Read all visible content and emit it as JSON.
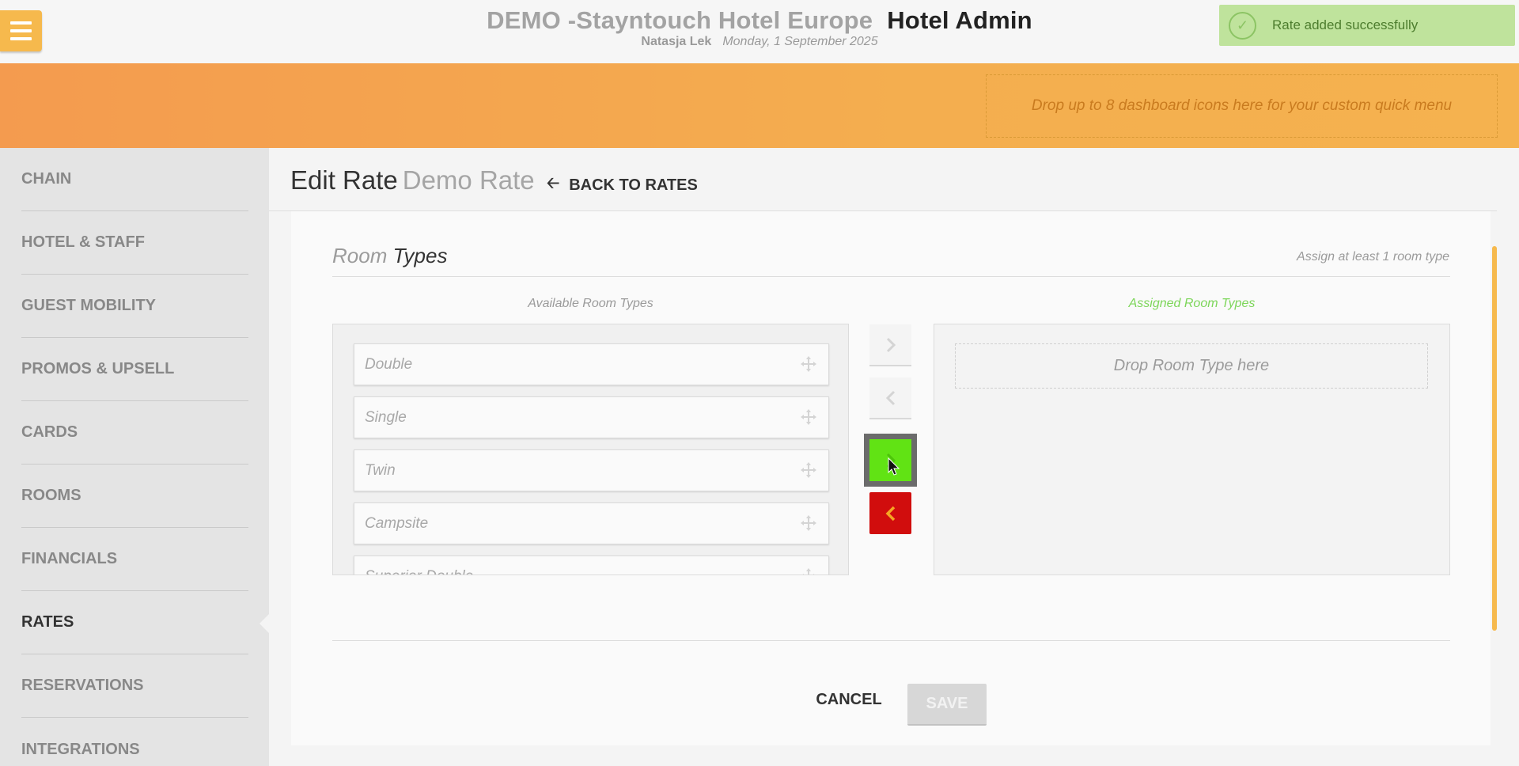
{
  "header": {
    "hotel_name": "DEMO -Stayntouch Hotel Europe",
    "app_name": "Hotel Admin",
    "user": "Natasja Lek",
    "date": "Monday, 1 September 2025",
    "menu_icon": "hamburger-menu-icon"
  },
  "toast": {
    "message": "Rate added successfully",
    "icon": "check-circle-icon"
  },
  "quick_menu": {
    "placeholder": "Drop up to 8 dashboard icons here for your custom quick menu"
  },
  "sidebar": {
    "items": [
      {
        "label": "CHAIN"
      },
      {
        "label": "HOTEL & STAFF"
      },
      {
        "label": "GUEST MOBILITY"
      },
      {
        "label": "PROMOS & UPSELL"
      },
      {
        "label": "CARDS"
      },
      {
        "label": "ROOMS"
      },
      {
        "label": "FINANCIALS"
      },
      {
        "label": "RATES",
        "active": true
      },
      {
        "label": "RESERVATIONS"
      },
      {
        "label": "INTEGRATIONS"
      }
    ]
  },
  "page": {
    "title": "Edit Rate",
    "rate_name": "Demo Rate",
    "back_label": "BACK TO RATES"
  },
  "room_types": {
    "title_light": "Room",
    "title_dark": "Types",
    "note": "Assign at least 1 room type",
    "available_label": "Available Room Types",
    "assigned_label": "Assigned Room Types",
    "available": [
      "Double",
      "Single",
      "Twin",
      "Campsite",
      "Superior Double"
    ],
    "drop_placeholder": "Drop Room Type here"
  },
  "actions": {
    "cancel_label": "CANCEL",
    "save_label": "SAVE"
  },
  "colors": {
    "accent_orange": "#f4a84f",
    "menu_yellow": "#f6b94d",
    "assign_green": "#61e314",
    "remove_red": "#d10d0d",
    "toast_green": "#bfe39c"
  }
}
